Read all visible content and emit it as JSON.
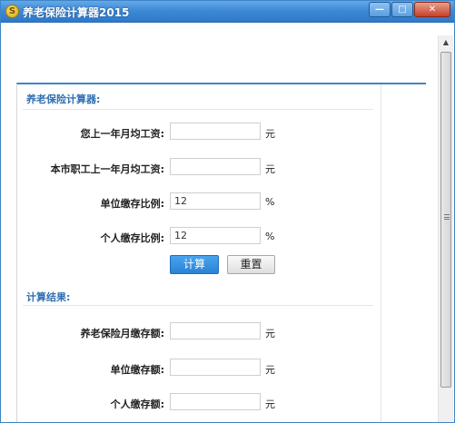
{
  "window": {
    "title": "养老保险计算器2015",
    "icon_glyph": "S",
    "controls": {
      "minimize": "—",
      "maximize": "□",
      "close": "✕"
    }
  },
  "scrollbar": {
    "up_arrow": "▲",
    "icon": "scroll-up-arrow-icon"
  },
  "calculator": {
    "section_title": "养老保险计算器:",
    "fields": [
      {
        "label": "您上一年月均工资:",
        "value": "",
        "unit": "元"
      },
      {
        "label": "本市职工上一年月均工资:",
        "value": "",
        "unit": "元"
      },
      {
        "label": "单位缴存比例:",
        "value": "12",
        "unit": "%"
      },
      {
        "label": "个人缴存比例:",
        "value": "12",
        "unit": "%"
      }
    ],
    "buttons": {
      "calculate": "计算",
      "reset": "重置"
    }
  },
  "results": {
    "section_title": "计算结果:",
    "fields": [
      {
        "label": "养老保险月缴存额:",
        "value": "",
        "unit": "元"
      },
      {
        "label": "单位缴存额:",
        "value": "",
        "unit": "元"
      },
      {
        "label": "个人缴存额:",
        "value": "",
        "unit": "元"
      }
    ]
  },
  "colors": {
    "titlebar": "#3f8ad6",
    "accent": "#2f6fb3",
    "primary_button": "#2a82d6"
  }
}
